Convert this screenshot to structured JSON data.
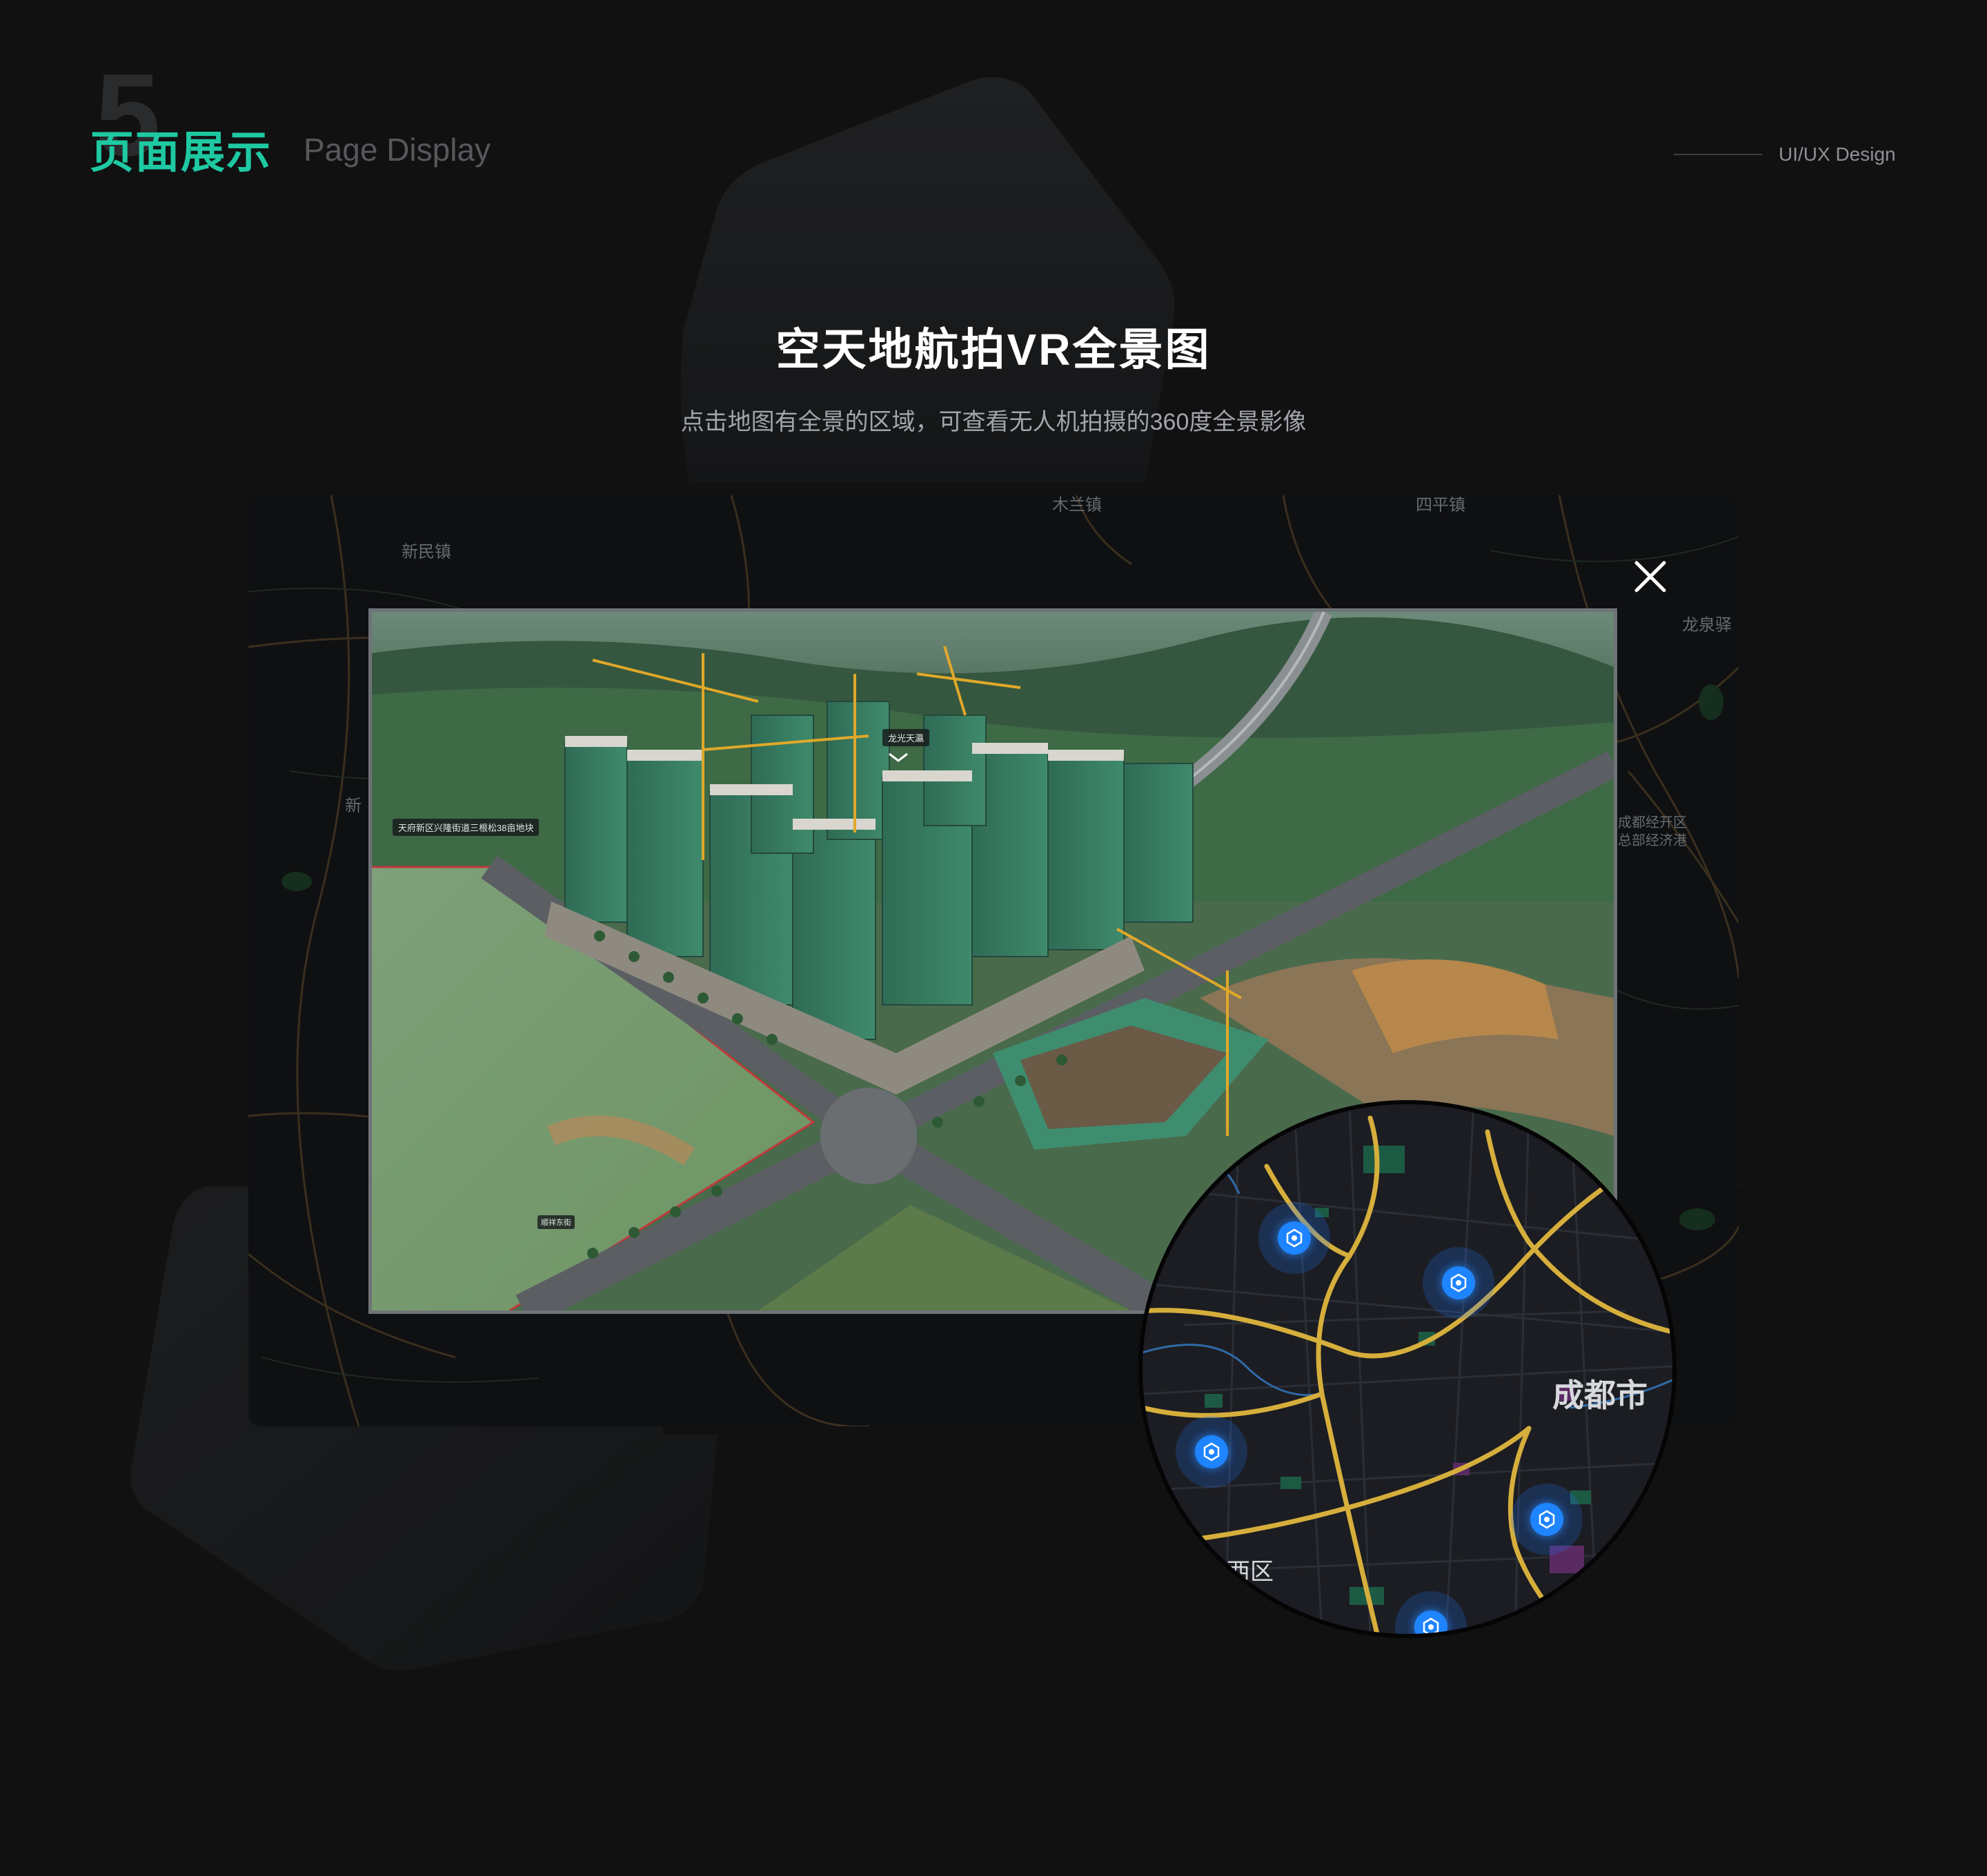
{
  "header": {
    "section_number": "5",
    "title_cn": "页面展示",
    "title_en": "Page Display",
    "tagline": "UI/UX Design"
  },
  "main": {
    "title": "空天地航拍VR全景图",
    "subtitle": "点击地图有全景的区域，可查看无人机拍摄的360度全景影像"
  },
  "background_map": {
    "labels": [
      "新民镇",
      "木兰镇",
      "四平镇",
      "龙泉驿",
      "新",
      "成都经开区",
      "总部经济港"
    ]
  },
  "panorama": {
    "tag_location": "龙光天瀛",
    "tag_plot": "天府新区兴隆街道三根松38亩地块",
    "tag_road": "顺祥东街"
  },
  "magnifier": {
    "city_label": "成都市",
    "district_label": "西区"
  },
  "colors": {
    "accent": "#1ec9a2",
    "marker": "#1f84ff",
    "road": "#d6ae3c"
  },
  "icons": {
    "close": "close-icon",
    "vr_marker": "vr-panorama-icon"
  }
}
